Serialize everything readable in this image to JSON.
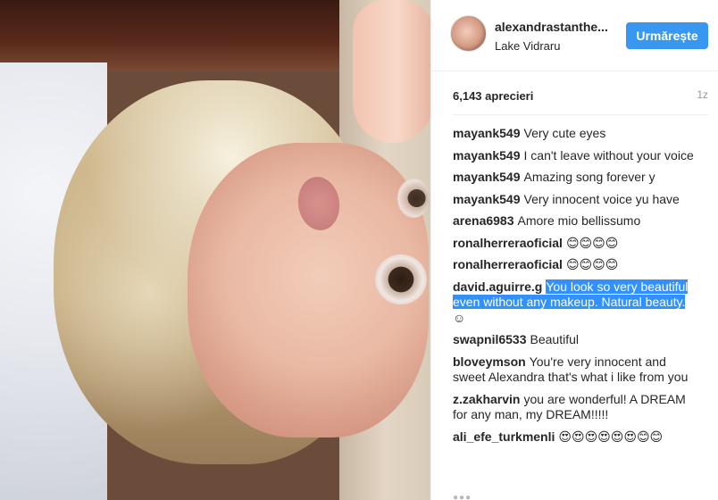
{
  "post": {
    "username": "alexandrastanthe...",
    "location": "Lake Vidraru",
    "follow_label": "Urmărește",
    "likes": "6,143 aprecieri",
    "time": "1z"
  },
  "comments": [
    {
      "author": "mayank549",
      "text": "Very cute eyes"
    },
    {
      "author": "mayank549",
      "text": "I can't leave without your voice"
    },
    {
      "author": "mayank549",
      "text": "Amazing song forever y"
    },
    {
      "author": "mayank549",
      "text": "Very innocent voice yu have"
    },
    {
      "author": "arena6983",
      "text": "Amore mio bellissumo"
    },
    {
      "author": "ronalherreraoficial",
      "text": "😊😊😊😊"
    },
    {
      "author": "ronalherreraoficial",
      "text": "😊😊😊😊"
    },
    {
      "author": "david.aguirre.g",
      "text_highlight": "You look so very beautiful even without any makeup. Natural beauty.",
      "text_rest": " ☺"
    },
    {
      "author": "swapnil6533",
      "text": "Beautiful"
    },
    {
      "author": "bloveymson",
      "text": "You're very innocent and sweet Alexandra that's what i like from you"
    },
    {
      "author": "z.zakharvin",
      "text": "you are wonderful! A DREAM for any man, my DREAM!!!!!"
    },
    {
      "author": "ali_efe_turkmenli",
      "text": "😍😍😍😍😍😍😊😊"
    }
  ],
  "icons": {
    "more": "ellipsis-icon"
  },
  "colors": {
    "accent": "#3897f0",
    "selection": "#3390ff",
    "muted": "#999999"
  }
}
